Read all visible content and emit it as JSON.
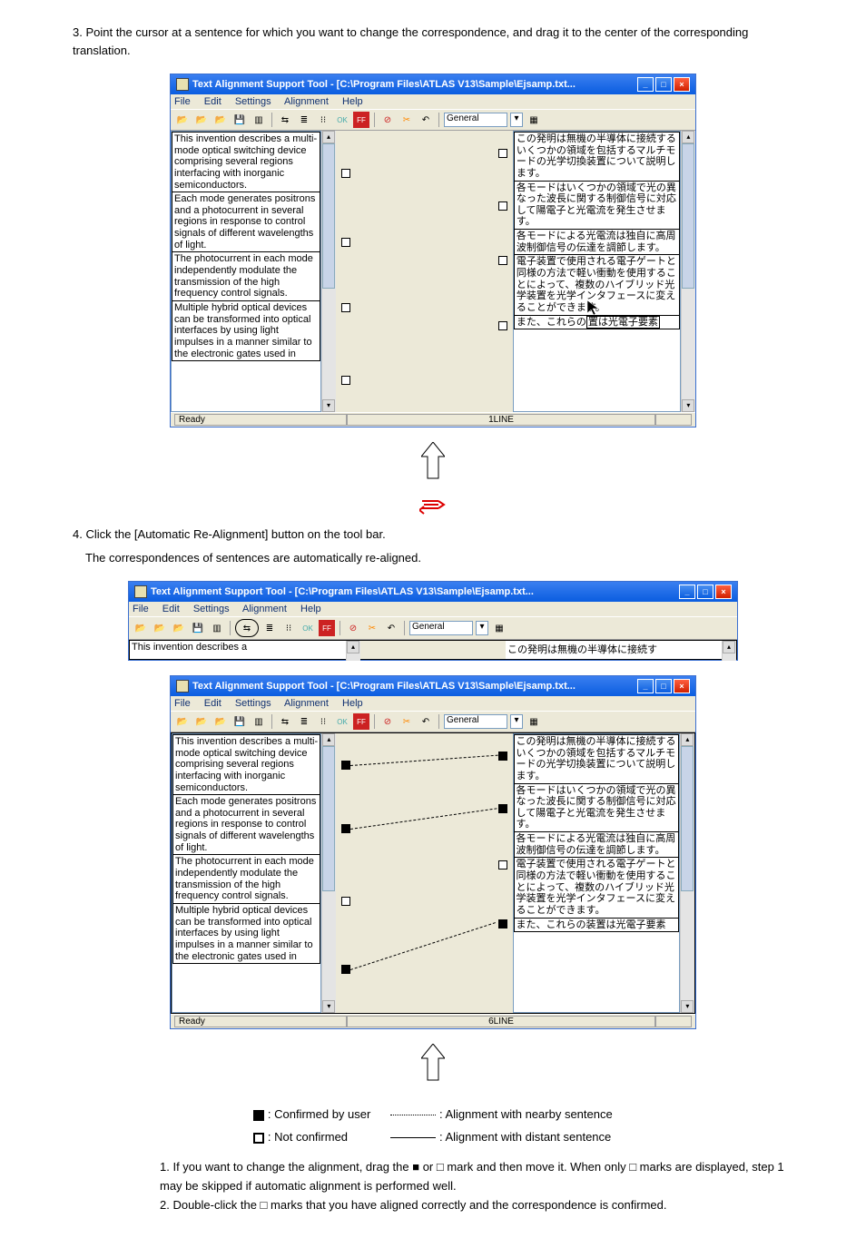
{
  "title_text": "Text Alignment Support Tool - [C:\\Program Files\\ATLAS V13\\Sample\\Ejsamp.txt...",
  "menu": {
    "file": "File",
    "edit": "Edit",
    "settings": "Settings",
    "alignment": "Alignment",
    "help": "Help"
  },
  "toolbar": {
    "ok": "OK",
    "ff": "FF",
    "combo": "General"
  },
  "status": {
    "ready": "Ready",
    "mode1": "1LINE",
    "mode6": "6LINE"
  },
  "left_blocks": [
    "This invention describes a multi-mode optical switching device comprising several regions interfacing with inorganic semiconductors.",
    "Each mode generates positrons and a photocurrent in several regions in response to control signals of different wavelengths of light.",
    "The photocurrent in each mode independently modulate the transmission of the high frequency control signals.",
    "Multiple hybrid optical devices can be transformed into optical interfaces by using light impulses in a manner similar to the electronic gates used in"
  ],
  "right_blocks": [
    "この発明は無機の半導体に接続するいくつかの領域を包括するマルチモードの光学切換装置について説明します。",
    "各モードはいくつかの領域で光の異なった波長に関する制御信号に対応して陽電子と光電流を発生させます。",
    "各モードによる光電流は独自に高周波制御信号の伝達を調節します。",
    "電子装置で使用される電子ゲートと同様の方法で軽い衝動を使用することによって、複数のハイブリッド光学装置を光学インタフェースに変えることができます。",
    "また、これらの装置は光電子要素"
  ],
  "right_block_split": {
    "prefix": "また、これらの",
    "suffix": "置は光電子要素"
  },
  "instr_top": "3. Point the cursor at a sentence for which you want to change the correspondence, and drag it to the center of the corresponding translation.",
  "instr_mid1": "4. Click the [Automatic Re-Alignment] button on the tool bar.",
  "instr_mid2": "  The correspondences of sentences are automatically re-aligned.",
  "legend": {
    "filled": " : Confirmed by user",
    "open": " : Not confirmed",
    "dotted": " : Alignment with nearby sentence",
    "solid": " : Alignment with distant sentence"
  },
  "notes": [
    "1. If you want to change the alignment, drag the ■ or □ mark and then move it. When only □ marks are displayed, step 1 may be skipped if automatic alignment is performed well.",
    "2. Double-click the □ marks that you have aligned correctly and the correspondence is confirmed."
  ],
  "short_left": "This invention describes a",
  "short_right": "この発明は無機の半導体に接続す",
  "multi_left_fig1": "Multiple hybrid optical devices can be transfo  ed into optical interfaces by u  ing light impulses in a manner sin  lar to the",
  "cursor_split": {
    "a": "Multiple hybrid optical devices can be transfo",
    "b": "ed into optical interfaces by u",
    "c": "ing light impulses in a manner sin",
    "d": "lar to the"
  }
}
